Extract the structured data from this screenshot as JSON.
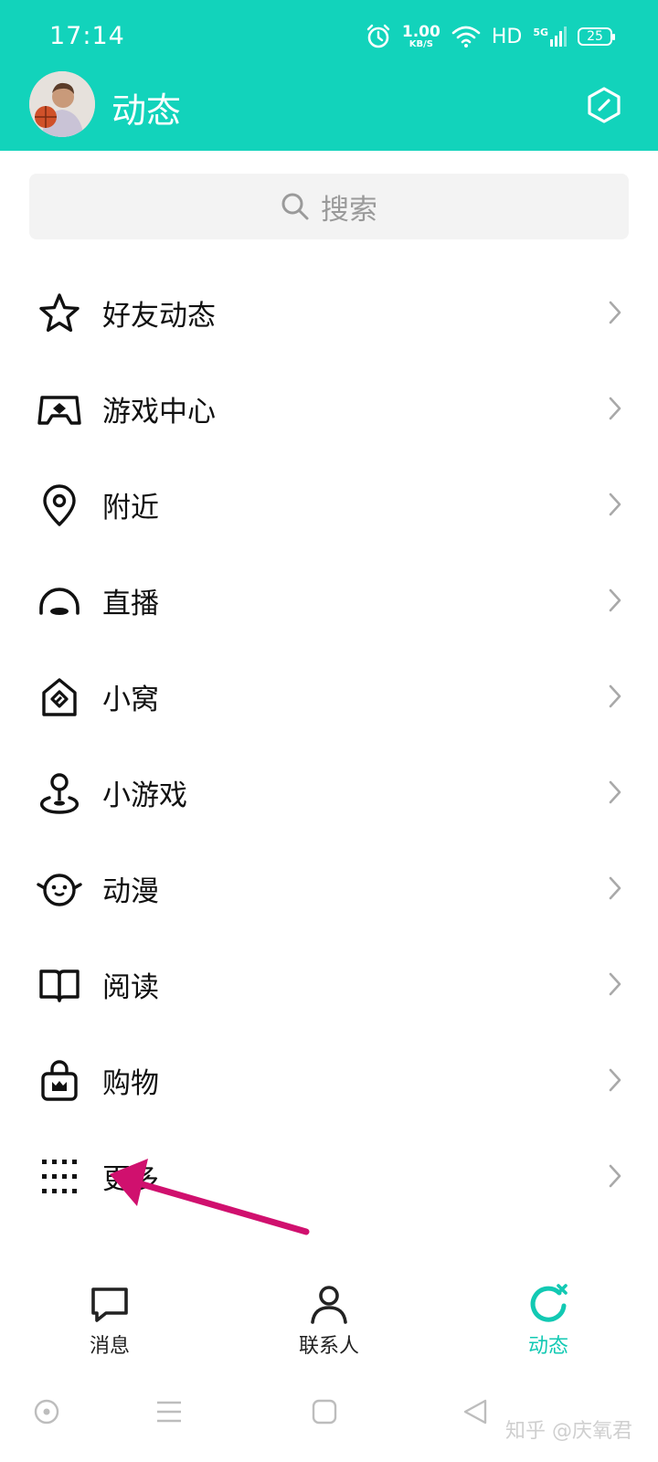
{
  "status_bar": {
    "time": "17:14",
    "net_speed_value": "1.00",
    "net_speed_unit": "KB/S",
    "hd": "HD",
    "signal": "5G",
    "battery": "25"
  },
  "header": {
    "title": "动态",
    "background_color": "#12d3bb",
    "settings_icon": "hexagon-check-icon"
  },
  "search": {
    "placeholder": "搜索",
    "icon": "search-icon"
  },
  "menu": {
    "items": [
      {
        "label": "好友动态",
        "icon": "star-icon"
      },
      {
        "label": "游戏中心",
        "icon": "gamepad-icon"
      },
      {
        "label": "附近",
        "icon": "location-pin-icon"
      },
      {
        "label": "直播",
        "icon": "live-icon"
      },
      {
        "label": "小窝",
        "icon": "home-diamond-icon"
      },
      {
        "label": "小游戏",
        "icon": "joystick-icon"
      },
      {
        "label": "动漫",
        "icon": "chick-face-icon"
      },
      {
        "label": "阅读",
        "icon": "book-icon"
      },
      {
        "label": "购物",
        "icon": "shopping-bag-icon"
      },
      {
        "label": "更多",
        "icon": "grid-dots-icon"
      }
    ]
  },
  "bottom_nav": {
    "tabs": [
      {
        "label": "消息",
        "icon": "chat-bubble-icon"
      },
      {
        "label": "联系人",
        "icon": "person-icon"
      },
      {
        "label": "动态",
        "icon": "refresh-star-icon",
        "active": true
      }
    ],
    "active_color": "#12c9b3"
  },
  "watermark": "知乎 @庆氧君",
  "annotation": {
    "arrow_color": "#d0106e"
  }
}
